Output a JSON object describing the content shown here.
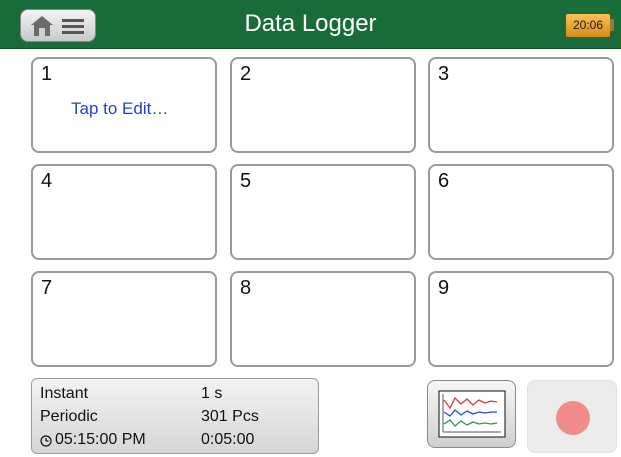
{
  "header": {
    "title": "Data Logger",
    "battery_time": "20:06",
    "background_color": "#1a6b3a"
  },
  "home_menu_button": {
    "icons": [
      "home-icon",
      "menu-icon"
    ]
  },
  "channels": [
    {
      "number": "1",
      "hint": "Tap to Edit…"
    },
    {
      "number": "2",
      "hint": ""
    },
    {
      "number": "3",
      "hint": ""
    },
    {
      "number": "4",
      "hint": ""
    },
    {
      "number": "5",
      "hint": ""
    },
    {
      "number": "6",
      "hint": ""
    },
    {
      "number": "7",
      "hint": ""
    },
    {
      "number": "8",
      "hint": ""
    },
    {
      "number": "9",
      "hint": ""
    }
  ],
  "info": {
    "trigger_label": "Instant",
    "interval_value": "1 s",
    "mode_label": "Periodic",
    "count_value": "301 Pcs",
    "start_time": "05:15:00 PM",
    "duration_value": "0:05:00"
  },
  "buttons": {
    "graph_icon": "graph-icon",
    "record_icon": "record-icon",
    "record_color": "#f28b8b"
  }
}
